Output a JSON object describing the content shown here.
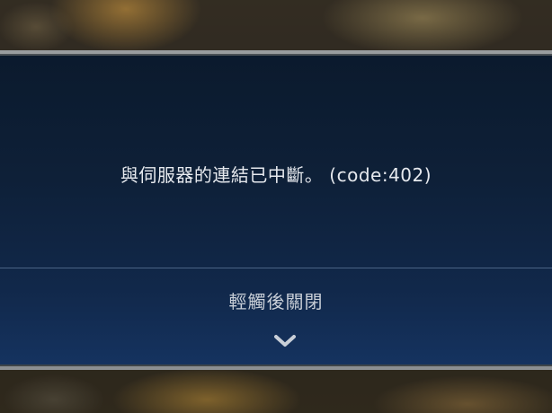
{
  "dialog": {
    "message": "與伺服器的連結已中斷。 (code:402)",
    "close_hint": "輕觸後關閉",
    "close_icon": "chevron-down-icon"
  },
  "colors": {
    "panel_top": "#0b1a2d",
    "panel_bottom": "#153360",
    "border": "#9a9d9f",
    "text": "#e6e9ee",
    "hint_text": "#c9cfd8"
  }
}
